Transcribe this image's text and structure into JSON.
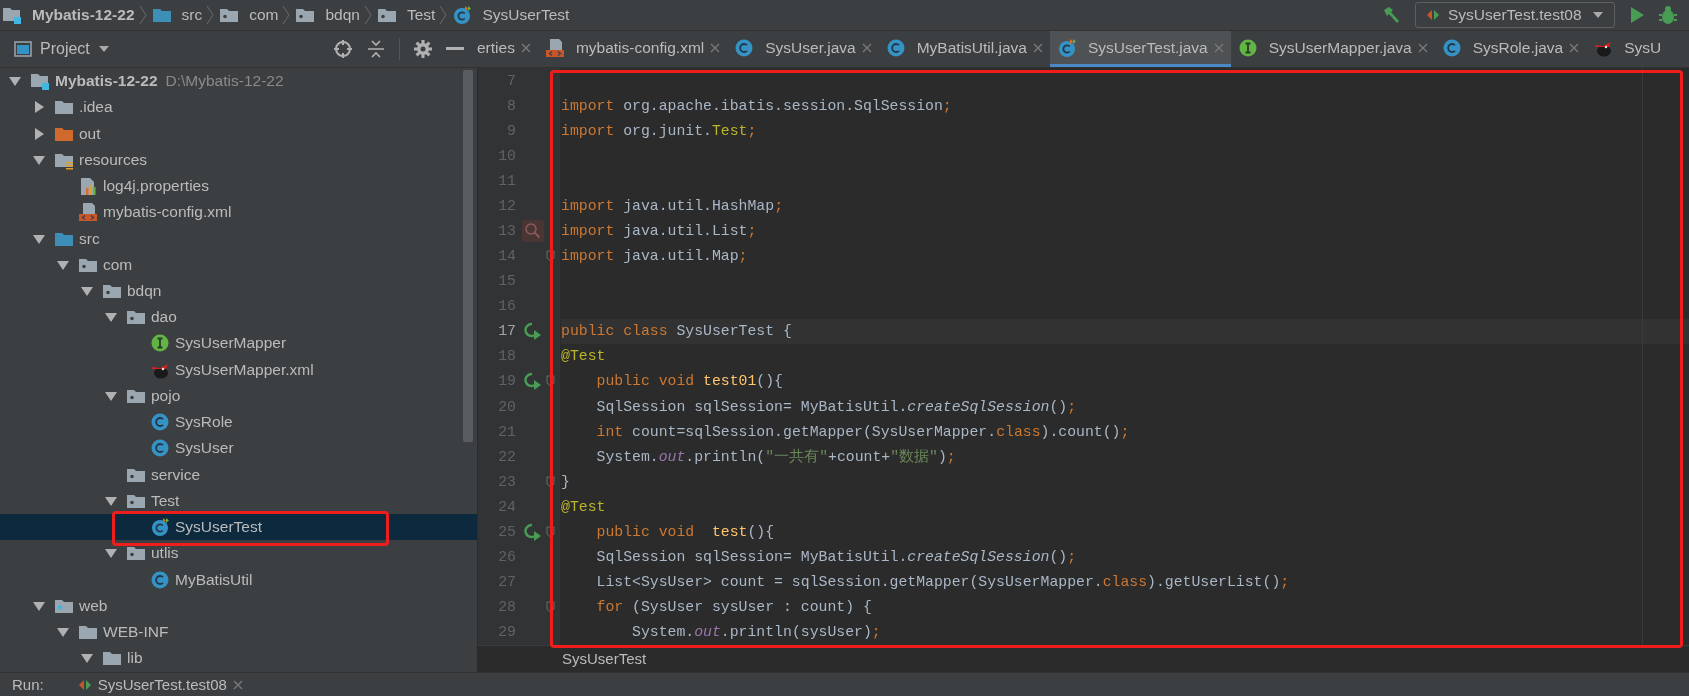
{
  "breadcrumbs": [
    {
      "label": "Mybatis-12-22",
      "kind": "module",
      "bold": true
    },
    {
      "label": "src",
      "kind": "source",
      "bold": false
    },
    {
      "label": "com",
      "kind": "package",
      "bold": false
    },
    {
      "label": "bdqn",
      "kind": "package",
      "bold": false
    },
    {
      "label": "Test",
      "kind": "package",
      "bold": false
    },
    {
      "label": "SysUserTest",
      "kind": "test-class",
      "bold": false
    }
  ],
  "run_configuration": {
    "label": "SysUserTest.test08"
  },
  "project_panel": {
    "title": "Project"
  },
  "tabs": [
    {
      "label": "erties",
      "selected": false
    },
    {
      "label": "mybatis-config.xml",
      "kind": "xml",
      "selected": false
    },
    {
      "label": "SysUser.java",
      "kind": "class",
      "selected": false
    },
    {
      "label": "MyBatisUtil.java",
      "kind": "class",
      "selected": false
    },
    {
      "label": "SysUserTest.java",
      "kind": "test-class",
      "selected": true
    },
    {
      "label": "SysUserMapper.java",
      "kind": "interface",
      "selected": false
    },
    {
      "label": "SysRole.java",
      "kind": "class",
      "selected": false
    },
    {
      "label": "SysU",
      "kind": "mybatis",
      "selected": false
    }
  ],
  "tree": [
    {
      "label": "Mybatis-12-22",
      "path": "D:\\Mybatis-12-22",
      "kind": "module",
      "expanded": true,
      "selected": false,
      "outlined": false,
      "children": [
        {
          "label": ".idea",
          "kind": "folder",
          "expanded": false,
          "selected": false,
          "outlined": false
        },
        {
          "label": "out",
          "kind": "folder-excluded",
          "expanded": false,
          "selected": false,
          "outlined": false
        },
        {
          "label": "resources",
          "kind": "resources",
          "expanded": true,
          "selected": false,
          "outlined": false,
          "children": [
            {
              "label": "log4j.properties",
              "kind": "properties",
              "selected": false,
              "outlined": false
            },
            {
              "label": "mybatis-config.xml",
              "kind": "xml",
              "selected": false,
              "outlined": false
            }
          ]
        },
        {
          "label": "src",
          "kind": "source",
          "expanded": true,
          "selected": false,
          "outlined": false,
          "children": [
            {
              "label": "com",
              "kind": "package",
              "expanded": true,
              "selected": false,
              "outlined": false,
              "children": [
                {
                  "label": "bdqn",
                  "kind": "package",
                  "expanded": true,
                  "selected": false,
                  "outlined": false,
                  "children": [
                    {
                      "label": "dao",
                      "kind": "package",
                      "expanded": true,
                      "selected": false,
                      "outlined": false,
                      "children": [
                        {
                          "label": "SysUserMapper",
                          "kind": "interface",
                          "selected": false,
                          "outlined": false
                        },
                        {
                          "label": "SysUserMapper.xml",
                          "kind": "mybatis",
                          "selected": false,
                          "outlined": false
                        }
                      ]
                    },
                    {
                      "label": "pojo",
                      "kind": "package",
                      "expanded": true,
                      "selected": false,
                      "outlined": false,
                      "children": [
                        {
                          "label": "SysRole",
                          "kind": "class",
                          "selected": false,
                          "outlined": false
                        },
                        {
                          "label": "SysUser",
                          "kind": "class",
                          "selected": false,
                          "outlined": false
                        }
                      ]
                    },
                    {
                      "label": "service",
                      "kind": "package",
                      "selected": false,
                      "outlined": false
                    },
                    {
                      "label": "Test",
                      "kind": "package",
                      "expanded": true,
                      "selected": false,
                      "outlined": false,
                      "children": [
                        {
                          "label": "SysUserTest",
                          "kind": "test-class",
                          "selected": true,
                          "outlined": true
                        }
                      ]
                    },
                    {
                      "label": "utlis",
                      "kind": "package",
                      "expanded": true,
                      "selected": false,
                      "outlined": false,
                      "children": [
                        {
                          "label": "MyBatisUtil",
                          "kind": "class",
                          "selected": false,
                          "outlined": false
                        }
                      ]
                    }
                  ]
                }
              ]
            }
          ]
        },
        {
          "label": "web",
          "kind": "web",
          "expanded": true,
          "selected": false,
          "outlined": false,
          "children": [
            {
              "label": "WEB-INF",
              "kind": "folder",
              "expanded": true,
              "selected": false,
              "outlined": false,
              "children": [
                {
                  "label": "lib",
                  "kind": "folder",
                  "expanded": true,
                  "selected": false,
                  "outlined": false
                }
              ]
            }
          ]
        }
      ]
    }
  ],
  "editor": {
    "outlined": true,
    "breadcrumb": "SysUserTest",
    "lines": [
      {
        "number": "7",
        "current": false
      },
      {
        "number": "8",
        "current": false,
        "tokens": [
          {
            "kind": "kw",
            "t": "import"
          },
          {
            "kind": "p",
            "t": " org.apache.ibatis.session.SqlSession"
          },
          {
            "kind": "kw",
            "t": ";"
          }
        ]
      },
      {
        "number": "9",
        "current": false,
        "tokens": [
          {
            "kind": "kw",
            "t": "import"
          },
          {
            "kind": "p",
            "t": " org.junit."
          },
          {
            "kind": "ann",
            "t": "Test"
          },
          {
            "kind": "kw",
            "t": ";"
          }
        ]
      },
      {
        "number": "10",
        "current": false
      },
      {
        "number": "11",
        "current": false
      },
      {
        "number": "12",
        "current": false,
        "tokens": [
          {
            "kind": "kw",
            "t": "import"
          },
          {
            "kind": "p",
            "t": " java.util.HashMap"
          },
          {
            "kind": "kw",
            "t": ";"
          }
        ]
      },
      {
        "number": "13",
        "current": false,
        "gutter_icons": [
          {
            "kind": "search"
          }
        ],
        "tokens": [
          {
            "kind": "kw",
            "t": "import"
          },
          {
            "kind": "p",
            "t": " java.util.List"
          },
          {
            "kind": "kw",
            "t": ";"
          }
        ]
      },
      {
        "number": "14",
        "current": false,
        "gutter_icons": [
          {
            "kind": "fold"
          }
        ],
        "tokens": [
          {
            "kind": "kw",
            "t": "import"
          },
          {
            "kind": "p",
            "t": " java.util.Map"
          },
          {
            "kind": "kw",
            "t": ";"
          }
        ]
      },
      {
        "number": "15",
        "current": false
      },
      {
        "number": "16",
        "current": false
      },
      {
        "number": "17",
        "current": true,
        "gutter_icons": [
          {
            "kind": "run"
          }
        ],
        "tokens": [
          {
            "kind": "kw",
            "t": "public class"
          },
          {
            "kind": "p",
            "t": " SysUserTest {"
          }
        ]
      },
      {
        "number": "18",
        "current": false,
        "tokens": [
          {
            "kind": "ann",
            "t": "@Test"
          }
        ]
      },
      {
        "number": "19",
        "current": false,
        "gutter_icons": [
          {
            "kind": "run"
          },
          {
            "kind": "fold"
          }
        ],
        "tokens": [
          {
            "kind": "kw",
            "t": "    public void "
          },
          {
            "kind": "decl",
            "t": "test01"
          },
          {
            "kind": "p",
            "t": "(){"
          }
        ]
      },
      {
        "number": "20",
        "current": false,
        "tokens": [
          {
            "kind": "p",
            "t": "    SqlSession sqlSession= MyBatisUtil."
          },
          {
            "kind": "static",
            "t": "createSqlSession"
          },
          {
            "kind": "p",
            "t": "()"
          },
          {
            "kind": "kw",
            "t": ";"
          }
        ]
      },
      {
        "number": "21",
        "current": false,
        "tokens": [
          {
            "kind": "kw",
            "t": "    int"
          },
          {
            "kind": "p",
            "t": " count=sqlSession.getMapper(SysUserMapper."
          },
          {
            "kind": "kw",
            "t": "class"
          },
          {
            "kind": "p",
            "t": ").count()"
          },
          {
            "kind": "kw",
            "t": ";"
          }
        ]
      },
      {
        "number": "22",
        "current": false,
        "tokens": [
          {
            "kind": "p",
            "t": "    System."
          },
          {
            "kind": "field",
            "t": "out"
          },
          {
            "kind": "p",
            "t": ".println("
          },
          {
            "kind": "str",
            "t": "\"一共有\""
          },
          {
            "kind": "p",
            "t": "+count+"
          },
          {
            "kind": "str",
            "t": "\"数据\""
          },
          {
            "kind": "p",
            "t": ")"
          },
          {
            "kind": "kw",
            "t": ";"
          }
        ]
      },
      {
        "number": "23",
        "current": false,
        "gutter_icons": [
          {
            "kind": "fold"
          }
        ],
        "tokens": [
          {
            "kind": "p",
            "t": "}"
          }
        ]
      },
      {
        "number": "24",
        "current": false,
        "tokens": [
          {
            "kind": "ann",
            "t": "@Test"
          }
        ]
      },
      {
        "number": "25",
        "current": false,
        "gutter_icons": [
          {
            "kind": "run"
          },
          {
            "kind": "fold"
          }
        ],
        "tokens": [
          {
            "kind": "kw",
            "t": "    public void  "
          },
          {
            "kind": "decl",
            "t": "test"
          },
          {
            "kind": "p",
            "t": "(){"
          }
        ]
      },
      {
        "number": "26",
        "current": false,
        "tokens": [
          {
            "kind": "p",
            "t": "    SqlSession sqlSession= MyBatisUtil."
          },
          {
            "kind": "static",
            "t": "createSqlSession"
          },
          {
            "kind": "p",
            "t": "()"
          },
          {
            "kind": "kw",
            "t": ";"
          }
        ]
      },
      {
        "number": "27",
        "current": false,
        "tokens": [
          {
            "kind": "p",
            "t": "    List<SysUser> count = sqlSession.getMapper(SysUserMapper."
          },
          {
            "kind": "kw",
            "t": "class"
          },
          {
            "kind": "p",
            "t": ").getUserList()"
          },
          {
            "kind": "kw",
            "t": ";"
          }
        ]
      },
      {
        "number": "28",
        "current": false,
        "gutter_icons": [
          {
            "kind": "fold"
          }
        ],
        "tokens": [
          {
            "kind": "kw",
            "t": "    for"
          },
          {
            "kind": "p",
            "t": " (SysUser sysUser : count) {"
          }
        ]
      },
      {
        "number": "29",
        "current": false,
        "tokens": [
          {
            "kind": "p",
            "t": "        System."
          },
          {
            "kind": "field",
            "t": "out"
          },
          {
            "kind": "p",
            "t": ".println(sysUser)"
          },
          {
            "kind": "kw",
            "t": ";"
          }
        ]
      }
    ]
  },
  "run_bar": {
    "label": "Run:",
    "tab": "SysUserTest.test08"
  }
}
